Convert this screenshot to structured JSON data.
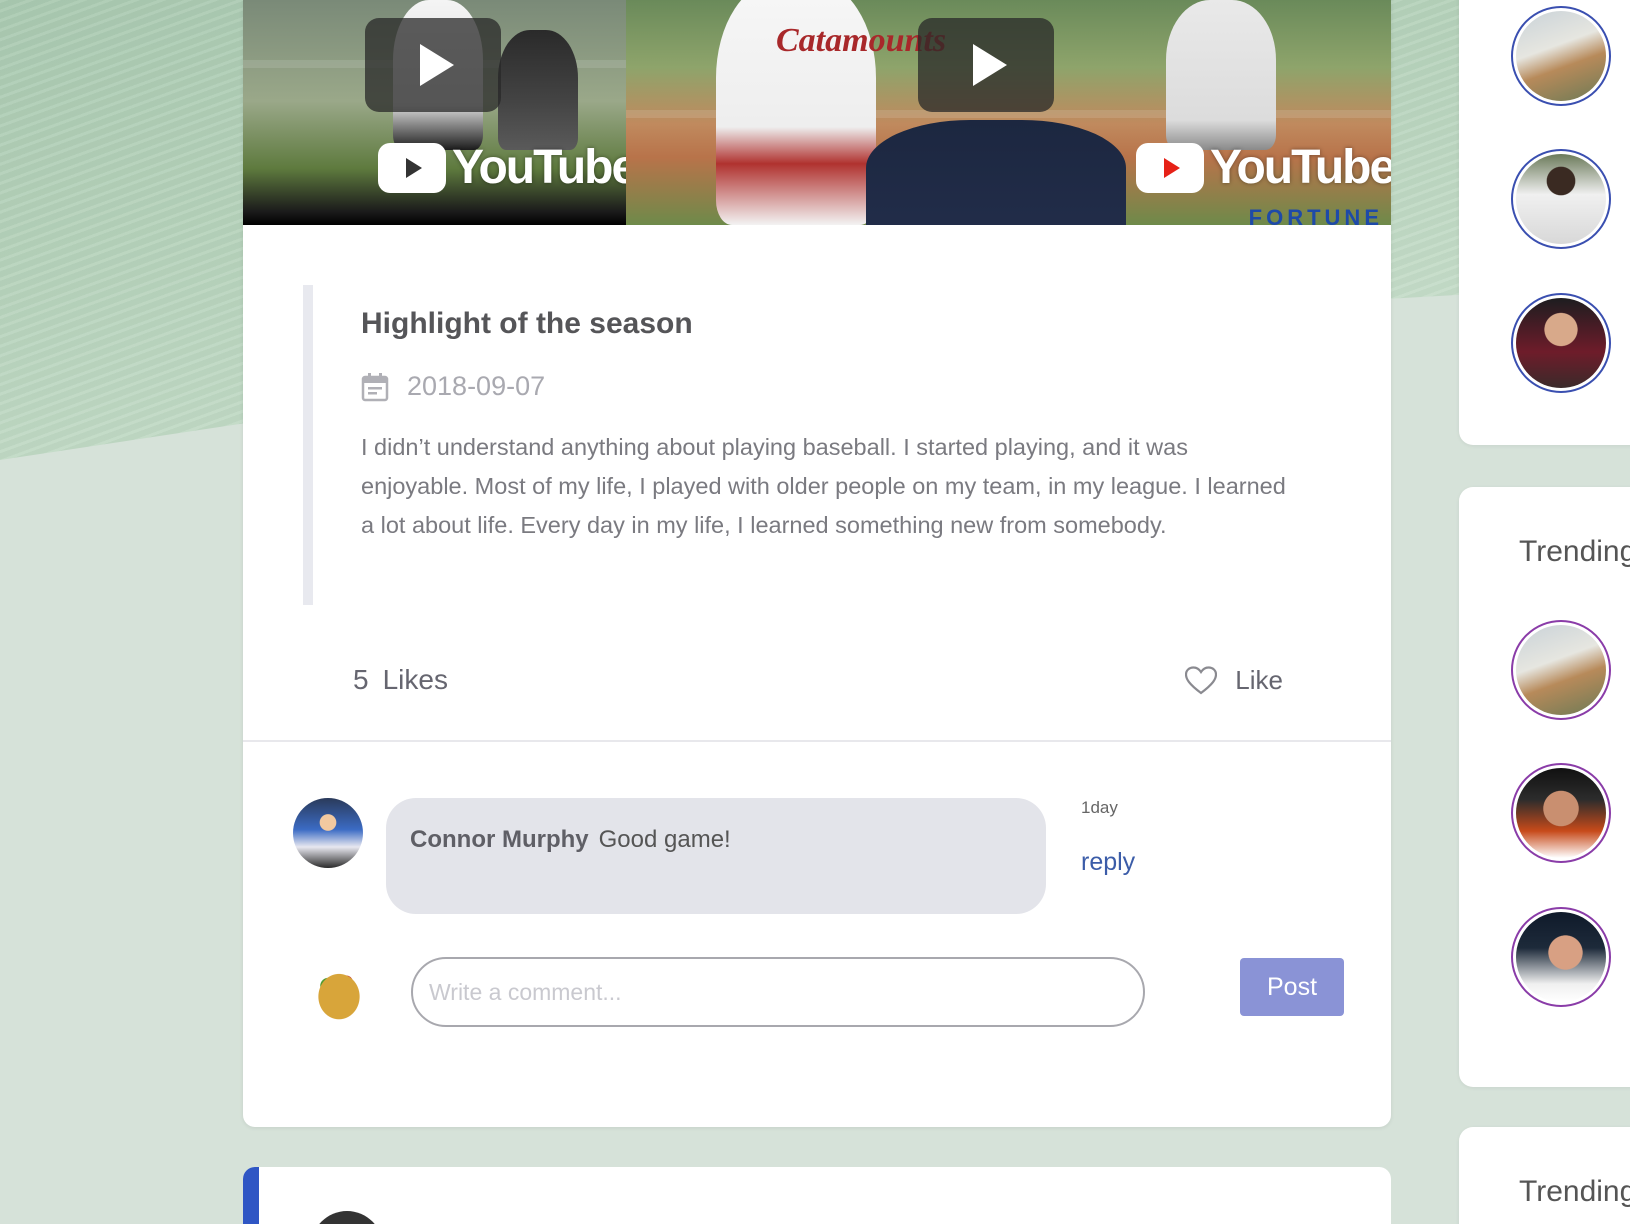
{
  "post": {
    "title": "Highlight of the season",
    "date": "2018-09-07",
    "text": "I didn’t understand anything about playing baseball. I started playing, and it was enjoyable. Most of my life, I played with older people on my team, in my league. I learned a lot about life. Every day in my life, I learned something new from somebody.",
    "likes_count": "5",
    "likes_label": "Likes",
    "like_button": "Like",
    "videos": [
      {
        "logo_text": "YouTube",
        "jersey_text": ""
      },
      {
        "logo_text": "YouTube",
        "jersey_text": "Catamounts",
        "brand_text": "FORTUNE"
      }
    ]
  },
  "comments": [
    {
      "author": "Connor Murphy",
      "text": "Good game!",
      "time": "1day",
      "reply_label": "reply"
    }
  ],
  "composer": {
    "placeholder": "Write a comment...",
    "post_button": "Post"
  },
  "sidebar": {
    "section_2_title": "Trending",
    "section_3_title": "Trending"
  },
  "icons": {
    "date": "calendar-icon",
    "like": "heart-outline-icon",
    "video": "play-icon"
  },
  "colors": {
    "post_button": "#8a93d6",
    "reply_link": "#3b5ca8",
    "avatar_ring_blue": "#3a4fb0",
    "avatar_ring_purple": "#8a3ca8",
    "accent_bar": "#2f56c4"
  }
}
